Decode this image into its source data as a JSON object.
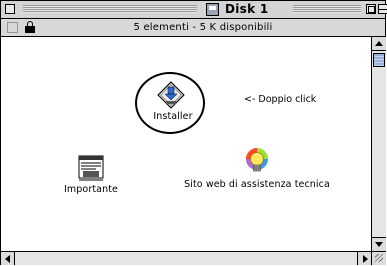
{
  "window": {
    "title": "Disk 1",
    "info": "5 elementi - 5 K disponibili"
  },
  "icons": {
    "installer": {
      "label": "Installer",
      "icon": "installer-icon"
    },
    "importante": {
      "label": "Importante",
      "icon": "document-icon"
    },
    "support": {
      "label": "Sito web di assistenza tecnica",
      "icon": "lightbulb-icon"
    }
  },
  "hint": "<- Doppio click",
  "colors": {
    "window_bg": "#dcdcdc",
    "content_bg": "#ffffff",
    "scroll_thumb": "#9ab0d8"
  }
}
